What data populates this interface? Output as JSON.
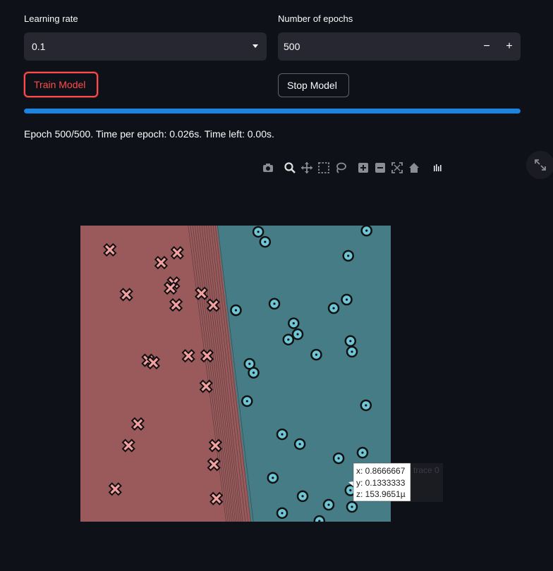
{
  "controls": {
    "learning_rate_label": "Learning rate",
    "learning_rate_value": "0.1",
    "epochs_label": "Number of epochs",
    "epochs_value": "500",
    "minus_label": "−",
    "plus_label": "+"
  },
  "buttons": {
    "train_label": "Train Model",
    "stop_label": "Stop Model"
  },
  "progress": {
    "fraction": 1.0
  },
  "status_text": "Epoch 500/500. Time per epoch: 0.026s. Time left: 0.00s.",
  "modebar_icons": [
    "camera-icon",
    "zoom-icon",
    "pan-icon",
    "box-select-icon",
    "lasso-icon",
    "zoom-in-icon",
    "zoom-out-icon",
    "autoscale-icon",
    "reset-axes-icon",
    "plotly-logo-icon"
  ],
  "colors": {
    "class0_region": "#9a5a5c",
    "class1_region": "#467c86",
    "cross_fill": "#f4a0a0",
    "circle_fill": "#6ec6d6",
    "accent_red": "#ff4b4b",
    "progress_blue": "#1c83e1"
  },
  "hover": {
    "x_line": "x: 0.8666667",
    "y_line": "y: 0.1333333",
    "z_line": "z: 153.9651µ",
    "trace_label": "trace 0"
  },
  "chart_data": {
    "type": "scatter",
    "title": "",
    "xlabel": "",
    "ylabel": "",
    "xlim": [
      0,
      1
    ],
    "ylim": [
      0,
      1
    ],
    "decision_boundary": {
      "top_x": 0.44,
      "bottom_x": 0.55
    },
    "series": [
      {
        "marker": "x",
        "points": [
          [
            0.095,
            0.918
          ],
          [
            0.312,
            0.908
          ],
          [
            0.26,
            0.875
          ],
          [
            0.3,
            0.806
          ],
          [
            0.29,
            0.789
          ],
          [
            0.148,
            0.767
          ],
          [
            0.39,
            0.771
          ],
          [
            0.308,
            0.732
          ],
          [
            0.428,
            0.731
          ],
          [
            0.218,
            0.545
          ],
          [
            0.235,
            0.537
          ],
          [
            0.348,
            0.56
          ],
          [
            0.408,
            0.56
          ],
          [
            0.405,
            0.457
          ],
          [
            0.185,
            0.33
          ],
          [
            0.155,
            0.257
          ],
          [
            0.435,
            0.257
          ],
          [
            0.43,
            0.193
          ],
          [
            0.112,
            0.11
          ],
          [
            0.438,
            0.078
          ]
        ]
      },
      {
        "marker": "o",
        "points": [
          [
            0.573,
            0.979
          ],
          [
            0.595,
            0.945
          ],
          [
            0.922,
            0.983
          ],
          [
            0.863,
            0.898
          ],
          [
            0.501,
            0.714
          ],
          [
            0.625,
            0.736
          ],
          [
            0.816,
            0.721
          ],
          [
            0.858,
            0.75
          ],
          [
            0.687,
            0.67
          ],
          [
            0.67,
            0.615
          ],
          [
            0.7,
            0.633
          ],
          [
            0.87,
            0.61
          ],
          [
            0.875,
            0.574
          ],
          [
            0.76,
            0.564
          ],
          [
            0.545,
            0.533
          ],
          [
            0.558,
            0.503
          ],
          [
            0.537,
            0.407
          ],
          [
            0.92,
            0.393
          ],
          [
            0.65,
            0.295
          ],
          [
            0.707,
            0.262
          ],
          [
            0.832,
            0.214
          ],
          [
            0.909,
            0.233
          ],
          [
            0.62,
            0.148
          ],
          [
            0.87,
            0.106
          ],
          [
            0.716,
            0.086
          ],
          [
            0.8,
            0.057
          ],
          [
            0.875,
            0.05
          ],
          [
            0.65,
            0.029
          ],
          [
            0.77,
            0.002
          ]
        ]
      }
    ]
  }
}
